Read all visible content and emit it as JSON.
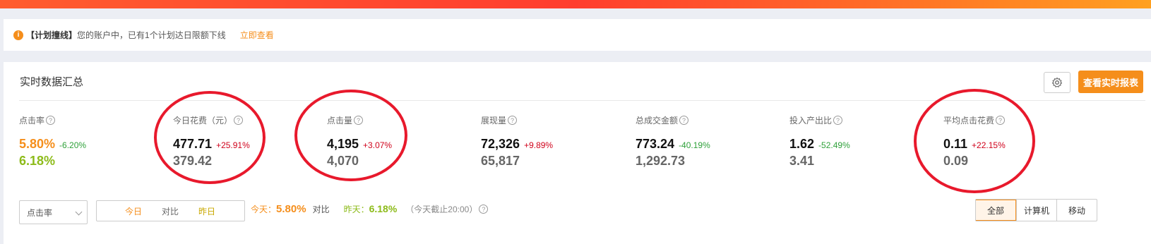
{
  "notice": {
    "tag": "【计划撞线】",
    "text": "您的账户中，已有1个计划达日限额下线",
    "link": "立即查看"
  },
  "panel": {
    "title": "实时数据汇总",
    "report_button": "查看实时报表"
  },
  "metrics": [
    {
      "label": "点击率",
      "today": "5.80%",
      "change": "-6.20%",
      "yesterday": "6.18%"
    },
    {
      "label": "今日花费（元）",
      "today": "477.71",
      "change": "+25.91%",
      "yesterday": "379.42"
    },
    {
      "label": "点击量",
      "today": "4,195",
      "change": "+3.07%",
      "yesterday": "4,070"
    },
    {
      "label": "展现量",
      "today": "72,326",
      "change": "+9.89%",
      "yesterday": "65,817"
    },
    {
      "label": "总成交金额",
      "today": "773.24",
      "change": "-40.19%",
      "yesterday": "1,292.73"
    },
    {
      "label": "投入产出比",
      "today": "1.62",
      "change": "-52.49%",
      "yesterday": "3.41"
    },
    {
      "label": "平均点击花费",
      "today": "0.11",
      "change": "+22.15%",
      "yesterday": "0.09"
    }
  ],
  "chart_controls": {
    "metric_select": "点击率",
    "segments": {
      "today": "今日",
      "vs": "对比",
      "yesterday": "昨日"
    },
    "legend": {
      "today_label": "今天：",
      "today_value": "5.80%",
      "vs": "对比",
      "yesterday_label": "昨天：",
      "yesterday_value": "6.18%",
      "note": "（今天截止20:00）"
    },
    "device_tabs": [
      "全部",
      "计算机",
      "移动"
    ]
  }
}
